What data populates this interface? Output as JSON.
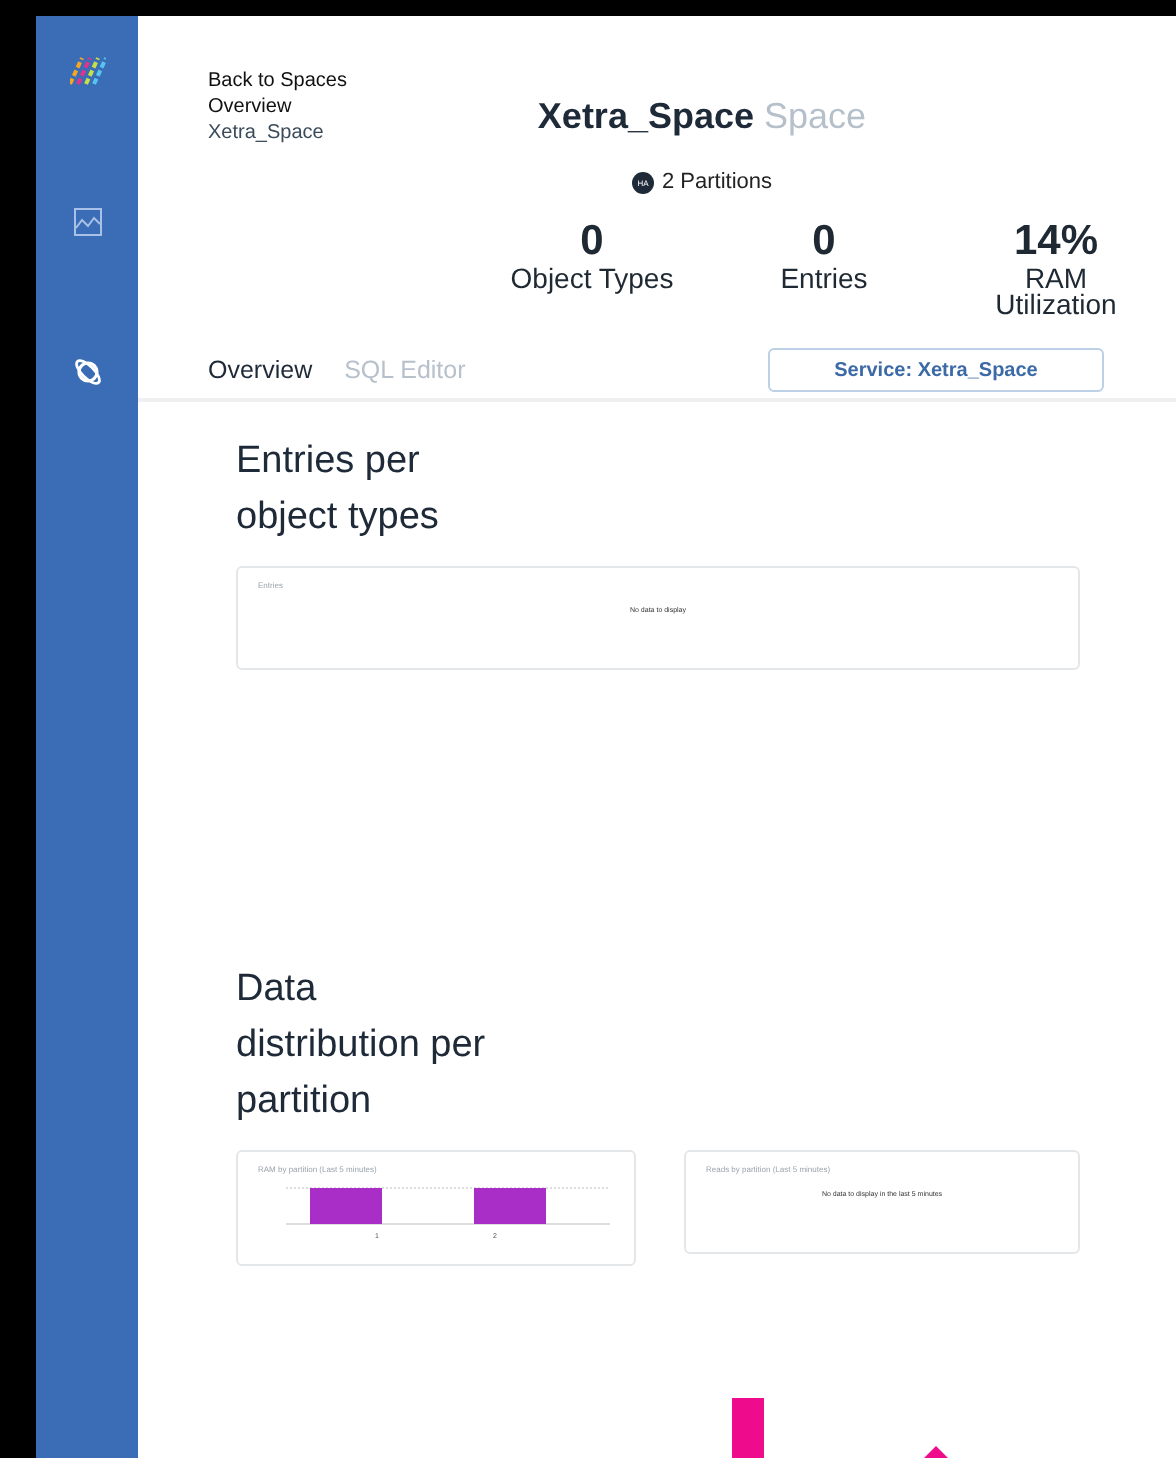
{
  "breadcrumbs": [
    {
      "label": "Back to Spaces",
      "kind": "link"
    },
    {
      "label": "Overview",
      "kind": "menu"
    },
    {
      "label": "Xetra_Space",
      "kind": "current"
    }
  ],
  "title": {
    "name": "Xetra_Space",
    "suffix": "Space"
  },
  "partitions": {
    "badge": "HA",
    "label": "2 Partitions"
  },
  "stats": [
    {
      "value": "0",
      "label": "Object Types"
    },
    {
      "value": "0",
      "label": "Entries"
    },
    {
      "value": "14%",
      "label": "RAM Utilization"
    }
  ],
  "tabs": [
    {
      "label": "Overview",
      "selected": true
    },
    {
      "label": "SQL Editor",
      "selected": false
    }
  ],
  "service_button": "Service: Xetra_Space",
  "sections": [
    {
      "heading": "Entries per object types",
      "cards": [
        {
          "kind": "empty",
          "title": "Entries",
          "message": "No data to display"
        }
      ]
    },
    {
      "heading": "Data distribution per partition",
      "cards": [
        {
          "kind": "bars",
          "title": "RAM by partition (Last 5 minutes)",
          "categories": [
            "1",
            "2"
          ]
        },
        {
          "kind": "empty",
          "title": "Reads by partition (Last 5 minutes)",
          "message": "No data to display in the last 5 minutes"
        }
      ]
    }
  ]
}
